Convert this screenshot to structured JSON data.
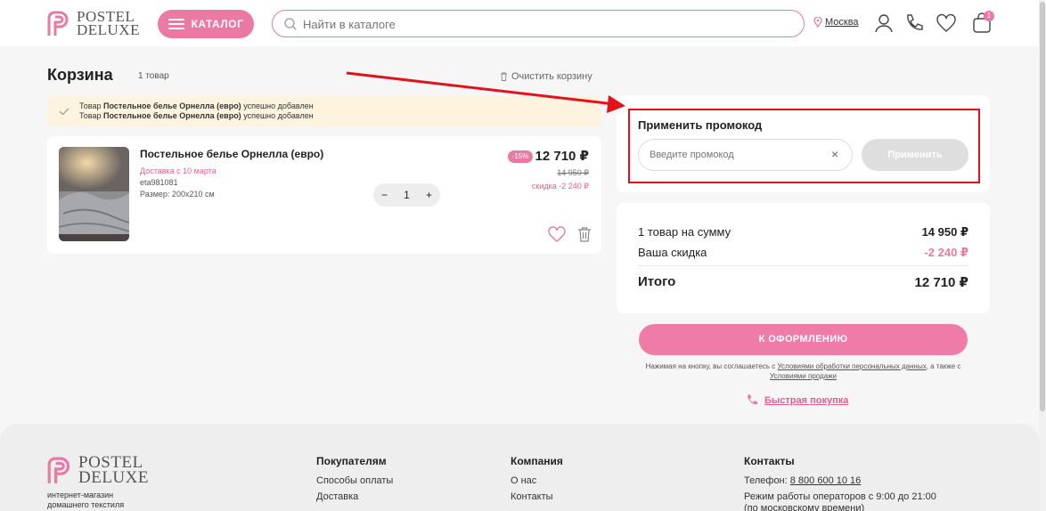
{
  "header": {
    "logo_line1": "POSTEL",
    "logo_line2": "DELUXE",
    "catalog_label": "КАТАЛОГ",
    "search_placeholder": "Найти в каталоге",
    "city": "Москва",
    "cart_count": "1"
  },
  "cart": {
    "title": "Корзина",
    "count": "1 товар",
    "clear_label": "Очистить корзину",
    "notices": [
      {
        "prefix": "Товар ",
        "name": "Постельное белье Орнелла (евро)",
        "suffix": " успешно добавлен"
      },
      {
        "prefix": "Товар ",
        "name": "Постельное белье Орнелла (евро)",
        "suffix": " успешно добавлен"
      }
    ],
    "item": {
      "name": "Постельное белье Орнелла (евро)",
      "delivery": "Доставка с 10 марта",
      "sku": "eta981081",
      "size": "Размер: 200х210 см",
      "quantity": "1",
      "minus": "−",
      "plus": "+",
      "discount_badge": "-15%",
      "price": "12 710 ₽",
      "old_price": "14 950 ₽",
      "discount_text": "скидка -2 240 ₽"
    }
  },
  "promo": {
    "title": "Применить промокод",
    "placeholder": "Введите промокод",
    "clear": "×",
    "apply_label": "Применить"
  },
  "summary": {
    "items_label": "1 товар на сумму",
    "items_value": "14 950 ₽",
    "discount_label": "Ваша скидка",
    "discount_value": "-2 240 ₽",
    "total_label": "Итого",
    "total_value": "12 710 ₽"
  },
  "checkout": {
    "button_label": "К ОФОРМЛЕНИЮ",
    "terms_pre": "Нажимая на кнопку, вы соглашаетесь с ",
    "terms_link1": "Условиями обработки персональных данных",
    "terms_mid": ", а также с ",
    "terms_link2": "Условиями продажи",
    "quick_label": "Быстрая покупка"
  },
  "footer": {
    "logo_line1": "POSTEL",
    "logo_line2": "DELUXE",
    "tagline1": "интернет-магазин",
    "tagline2": "домашнего текстиля",
    "col1_title": "Покупателям",
    "col1_links": [
      "Способы оплаты",
      "Доставка"
    ],
    "col2_title": "Компания",
    "col2_links": [
      "О нас",
      "Контакты"
    ],
    "col3_title": "Контакты",
    "phone_label": "Телефон: ",
    "phone": "8 800 600 10 16",
    "hours1": "Режим работы операторов с 9:00 до 21:00",
    "hours2": "(по московскому времени)"
  },
  "colors": {
    "accent": "#ea7aa1",
    "annotation": "#e2121c"
  }
}
